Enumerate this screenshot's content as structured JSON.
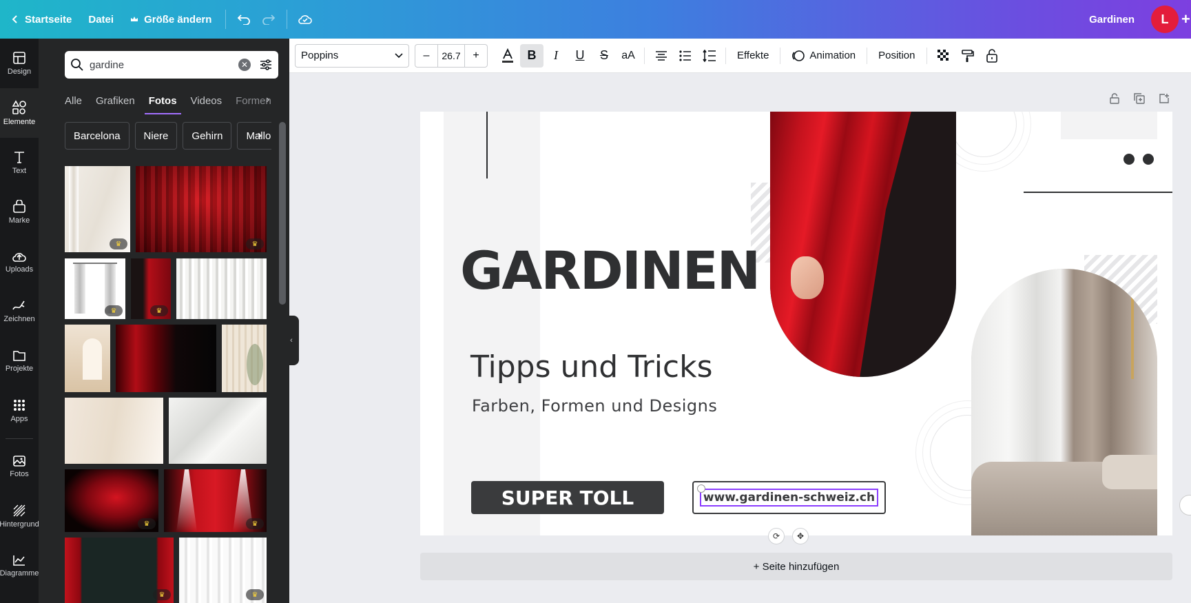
{
  "topbar": {
    "home_label": "Startseite",
    "file_label": "Datei",
    "resize_label": "Größe ändern",
    "doc_title": "Gardinen",
    "avatar_initial": "L",
    "gradient_start": "#1fb6c9",
    "gradient_end": "#7d3fe0"
  },
  "rail": {
    "items": [
      {
        "label": "Design",
        "icon": "design-icon"
      },
      {
        "label": "Elemente",
        "icon": "elements-icon"
      },
      {
        "label": "Text",
        "icon": "text-icon"
      },
      {
        "label": "Marke",
        "icon": "brand-icon"
      },
      {
        "label": "Uploads",
        "icon": "upload-icon"
      },
      {
        "label": "Zeichnen",
        "icon": "draw-icon"
      },
      {
        "label": "Projekte",
        "icon": "folder-icon"
      },
      {
        "label": "Apps",
        "icon": "apps-icon"
      },
      {
        "label": "Fotos",
        "icon": "photo-icon"
      },
      {
        "label": "Hintergrund",
        "icon": "background-icon"
      },
      {
        "label": "Diagramme",
        "icon": "chart-icon"
      }
    ],
    "active_index": 1
  },
  "panel": {
    "search_value": "gardine",
    "tabs": [
      "Alle",
      "Grafiken",
      "Fotos",
      "Videos",
      "Formen"
    ],
    "active_tab": "Fotos",
    "chips": [
      "Barcelona",
      "Niere",
      "Gehirn",
      "Mallorca"
    ]
  },
  "format": {
    "font": "Poppins",
    "size": "26.7",
    "effects_label": "Effekte",
    "animation_label": "Animation",
    "position_label": "Position"
  },
  "design": {
    "heading": "GARDINEN",
    "subheading": "Tipps und Tricks",
    "tagline": "Farben, Formen und Designs",
    "button_label": "SUPER TOLL",
    "url_label": "www.gardinen-schweiz.ch"
  },
  "add_page_label": "+ Seite hinzufügen",
  "colors": {
    "accent": "#8b3dff",
    "curtain_red": "#c0101a",
    "dark": "#2f3032"
  }
}
